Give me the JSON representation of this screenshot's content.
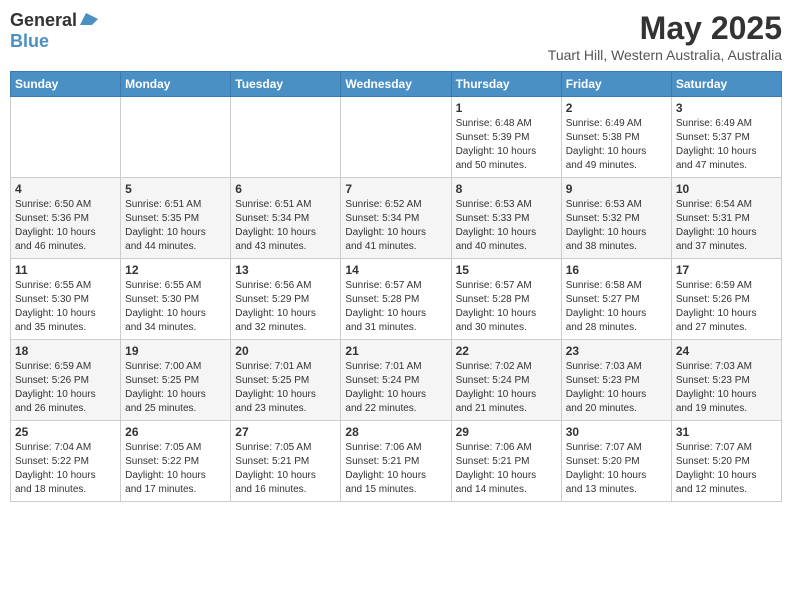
{
  "logo": {
    "line1": "General",
    "line2": "Blue"
  },
  "title": "May 2025",
  "subtitle": "Tuart Hill, Western Australia, Australia",
  "days_of_week": [
    "Sunday",
    "Monday",
    "Tuesday",
    "Wednesday",
    "Thursday",
    "Friday",
    "Saturday"
  ],
  "weeks": [
    [
      {
        "day": "",
        "info": ""
      },
      {
        "day": "",
        "info": ""
      },
      {
        "day": "",
        "info": ""
      },
      {
        "day": "",
        "info": ""
      },
      {
        "day": "1",
        "info": "Sunrise: 6:48 AM\nSunset: 5:39 PM\nDaylight: 10 hours\nand 50 minutes."
      },
      {
        "day": "2",
        "info": "Sunrise: 6:49 AM\nSunset: 5:38 PM\nDaylight: 10 hours\nand 49 minutes."
      },
      {
        "day": "3",
        "info": "Sunrise: 6:49 AM\nSunset: 5:37 PM\nDaylight: 10 hours\nand 47 minutes."
      }
    ],
    [
      {
        "day": "4",
        "info": "Sunrise: 6:50 AM\nSunset: 5:36 PM\nDaylight: 10 hours\nand 46 minutes."
      },
      {
        "day": "5",
        "info": "Sunrise: 6:51 AM\nSunset: 5:35 PM\nDaylight: 10 hours\nand 44 minutes."
      },
      {
        "day": "6",
        "info": "Sunrise: 6:51 AM\nSunset: 5:34 PM\nDaylight: 10 hours\nand 43 minutes."
      },
      {
        "day": "7",
        "info": "Sunrise: 6:52 AM\nSunset: 5:34 PM\nDaylight: 10 hours\nand 41 minutes."
      },
      {
        "day": "8",
        "info": "Sunrise: 6:53 AM\nSunset: 5:33 PM\nDaylight: 10 hours\nand 40 minutes."
      },
      {
        "day": "9",
        "info": "Sunrise: 6:53 AM\nSunset: 5:32 PM\nDaylight: 10 hours\nand 38 minutes."
      },
      {
        "day": "10",
        "info": "Sunrise: 6:54 AM\nSunset: 5:31 PM\nDaylight: 10 hours\nand 37 minutes."
      }
    ],
    [
      {
        "day": "11",
        "info": "Sunrise: 6:55 AM\nSunset: 5:30 PM\nDaylight: 10 hours\nand 35 minutes."
      },
      {
        "day": "12",
        "info": "Sunrise: 6:55 AM\nSunset: 5:30 PM\nDaylight: 10 hours\nand 34 minutes."
      },
      {
        "day": "13",
        "info": "Sunrise: 6:56 AM\nSunset: 5:29 PM\nDaylight: 10 hours\nand 32 minutes."
      },
      {
        "day": "14",
        "info": "Sunrise: 6:57 AM\nSunset: 5:28 PM\nDaylight: 10 hours\nand 31 minutes."
      },
      {
        "day": "15",
        "info": "Sunrise: 6:57 AM\nSunset: 5:28 PM\nDaylight: 10 hours\nand 30 minutes."
      },
      {
        "day": "16",
        "info": "Sunrise: 6:58 AM\nSunset: 5:27 PM\nDaylight: 10 hours\nand 28 minutes."
      },
      {
        "day": "17",
        "info": "Sunrise: 6:59 AM\nSunset: 5:26 PM\nDaylight: 10 hours\nand 27 minutes."
      }
    ],
    [
      {
        "day": "18",
        "info": "Sunrise: 6:59 AM\nSunset: 5:26 PM\nDaylight: 10 hours\nand 26 minutes."
      },
      {
        "day": "19",
        "info": "Sunrise: 7:00 AM\nSunset: 5:25 PM\nDaylight: 10 hours\nand 25 minutes."
      },
      {
        "day": "20",
        "info": "Sunrise: 7:01 AM\nSunset: 5:25 PM\nDaylight: 10 hours\nand 23 minutes."
      },
      {
        "day": "21",
        "info": "Sunrise: 7:01 AM\nSunset: 5:24 PM\nDaylight: 10 hours\nand 22 minutes."
      },
      {
        "day": "22",
        "info": "Sunrise: 7:02 AM\nSunset: 5:24 PM\nDaylight: 10 hours\nand 21 minutes."
      },
      {
        "day": "23",
        "info": "Sunrise: 7:03 AM\nSunset: 5:23 PM\nDaylight: 10 hours\nand 20 minutes."
      },
      {
        "day": "24",
        "info": "Sunrise: 7:03 AM\nSunset: 5:23 PM\nDaylight: 10 hours\nand 19 minutes."
      }
    ],
    [
      {
        "day": "25",
        "info": "Sunrise: 7:04 AM\nSunset: 5:22 PM\nDaylight: 10 hours\nand 18 minutes."
      },
      {
        "day": "26",
        "info": "Sunrise: 7:05 AM\nSunset: 5:22 PM\nDaylight: 10 hours\nand 17 minutes."
      },
      {
        "day": "27",
        "info": "Sunrise: 7:05 AM\nSunset: 5:21 PM\nDaylight: 10 hours\nand 16 minutes."
      },
      {
        "day": "28",
        "info": "Sunrise: 7:06 AM\nSunset: 5:21 PM\nDaylight: 10 hours\nand 15 minutes."
      },
      {
        "day": "29",
        "info": "Sunrise: 7:06 AM\nSunset: 5:21 PM\nDaylight: 10 hours\nand 14 minutes."
      },
      {
        "day": "30",
        "info": "Sunrise: 7:07 AM\nSunset: 5:20 PM\nDaylight: 10 hours\nand 13 minutes."
      },
      {
        "day": "31",
        "info": "Sunrise: 7:07 AM\nSunset: 5:20 PM\nDaylight: 10 hours\nand 12 minutes."
      }
    ]
  ]
}
